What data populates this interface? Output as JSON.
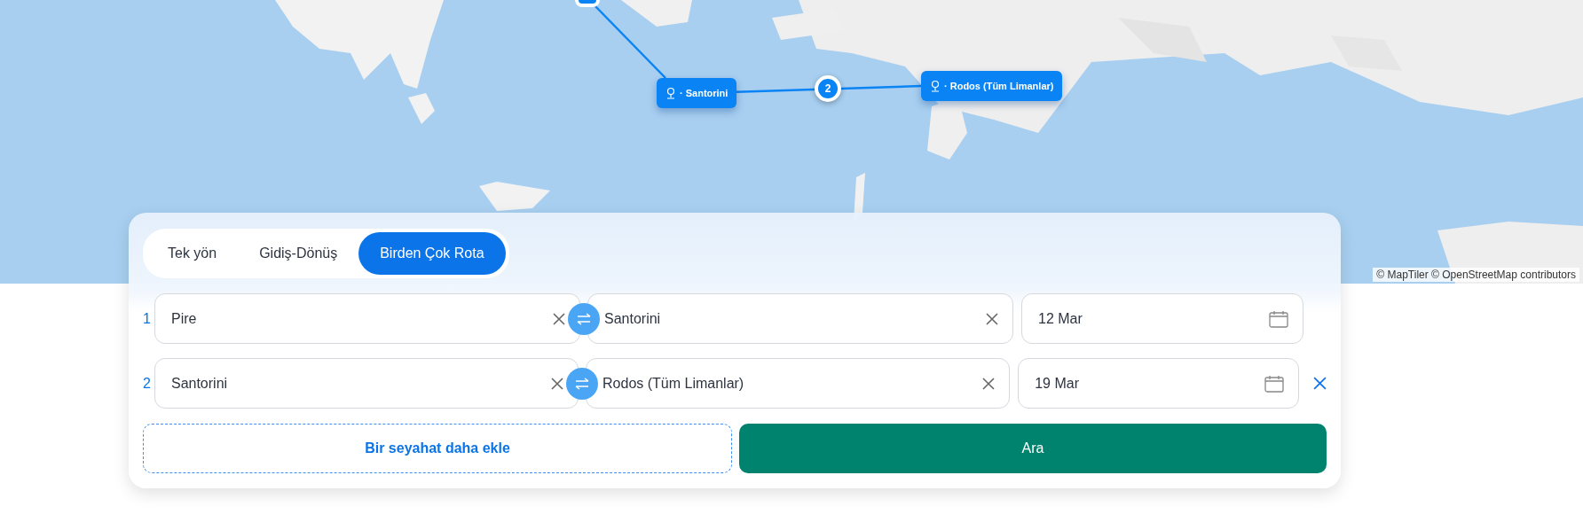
{
  "map": {
    "kind": "picture",
    "markers": [
      {
        "label": "· Santorini"
      },
      {
        "label": "· Rodos (Tüm Limanlar)"
      }
    ],
    "stop_badge": "2",
    "attribution": "© MapTiler © OpenStreetMap contributors"
  },
  "tabs": [
    {
      "label": "Tek yön",
      "selected": false
    },
    {
      "label": "Gidiş-Dönüş",
      "selected": false
    },
    {
      "label": "Birden Çok Rota",
      "selected": true
    }
  ],
  "legs": [
    {
      "number": "1",
      "origin": "Pire",
      "destination": "Santorini",
      "date": "12 Mar",
      "removable": false
    },
    {
      "number": "2",
      "origin": "Santorini",
      "destination": "Rodos (Tüm Limanlar)",
      "date": "19 Mar",
      "removable": true
    }
  ],
  "add_button": "Bir seyahat daha ekle",
  "search_button": "Ara"
}
